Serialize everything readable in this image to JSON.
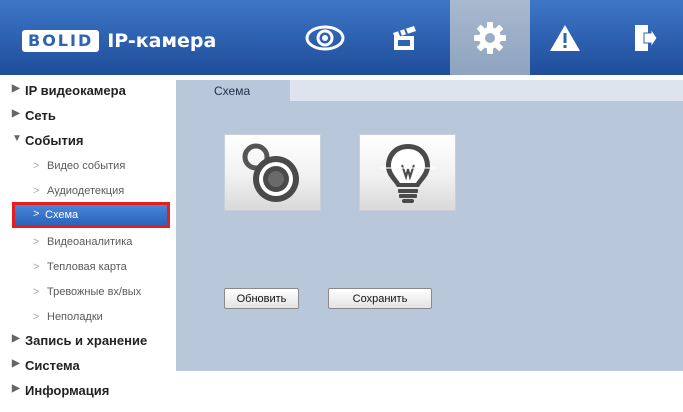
{
  "header": {
    "logo_mark": "BOLID",
    "app_title": "IP-камера",
    "nav_icons": [
      "live-view-icon",
      "playback-icon",
      "settings-icon",
      "alarm-icon",
      "logout-icon"
    ],
    "active_icon": "settings-icon",
    "colors": {
      "header_bg": "#2f63b3",
      "active_tab": "#9aadc6"
    }
  },
  "sidebar": {
    "groups": [
      {
        "label": "IP видеокамера",
        "expanded": false
      },
      {
        "label": "Сеть",
        "expanded": false
      },
      {
        "label": "События",
        "expanded": true,
        "children": [
          {
            "label": "Видео события",
            "active": false
          },
          {
            "label": "Аудиодетекция",
            "active": false
          },
          {
            "label": "Схема",
            "active": true
          },
          {
            "label": "Видеоаналитика",
            "active": false
          },
          {
            "label": "Тепловая карта",
            "active": false
          },
          {
            "label": "Тревожные вх/вых",
            "active": false
          },
          {
            "label": "Неполадки",
            "active": false
          }
        ]
      },
      {
        "label": "Запись и хранение",
        "expanded": false
      },
      {
        "label": "Система",
        "expanded": false
      },
      {
        "label": "Информация",
        "expanded": false
      }
    ],
    "highlight_color": "#e41f1f"
  },
  "main": {
    "tab_label": "Схема",
    "tiles": [
      {
        "icon": "camera-lens-icon"
      },
      {
        "icon": "light-bulb-icon"
      }
    ],
    "buttons": {
      "refresh": "Обновить",
      "save": "Сохранить"
    },
    "colors": {
      "panel_bg": "#b9c7da"
    }
  }
}
